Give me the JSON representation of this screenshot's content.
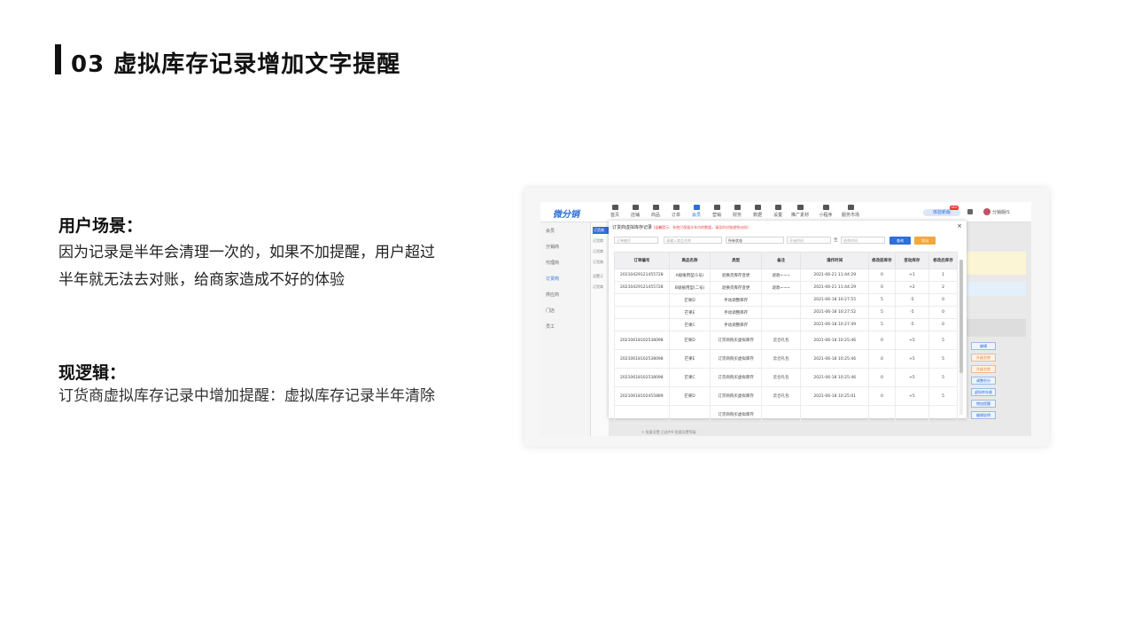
{
  "slide": {
    "title": "03 虚拟库存记录增加文字提醒",
    "scene_heading": "用户场景：",
    "scene_text": "因为记录是半年会清理一次的，如果不加提醒，用户超过半年就无法去对账，给商家造成不好的体验",
    "logic_heading": "现逻辑：",
    "logic_text": "订货商虚拟库存记录中增加提醒：虚拟库存记录半年清除"
  },
  "app": {
    "logo": "微分销",
    "nav": [
      {
        "label": "首页",
        "icon": "home-icon"
      },
      {
        "label": "店铺",
        "icon": "store-icon"
      },
      {
        "label": "商品",
        "icon": "goods-icon"
      },
      {
        "label": "订单",
        "icon": "order-icon"
      },
      {
        "label": "会员",
        "icon": "member-icon"
      },
      {
        "label": "营销",
        "icon": "marketing-icon"
      },
      {
        "label": "财务",
        "icon": "finance-icon"
      },
      {
        "label": "数据",
        "icon": "chart-icon"
      },
      {
        "label": "设置",
        "icon": "gear-icon"
      },
      {
        "label": "推广素材",
        "icon": "share-icon"
      },
      {
        "label": "小程序",
        "icon": "miniprogram-icon"
      },
      {
        "label": "服务市场",
        "icon": "market-icon"
      }
    ],
    "header_pill": "体验新版",
    "header_badge": "NEW",
    "user": "分销版IS",
    "sidebar": [
      "会员",
      "分销商",
      "代理商",
      "订货商",
      "供应商",
      "门店",
      "员工"
    ],
    "subnav": [
      "订货商",
      "订货商",
      "订货商",
      "订货商",
      "设置订",
      "订货商"
    ],
    "right_buttons": [
      "编辑",
      "升级名称",
      "升级名称",
      "调整积分",
      "虚拟库存维",
      "增加提醒",
      "编辑说明"
    ],
    "bottom_text": "+ 批量设置   已选中0   批量设置等级"
  },
  "modal": {
    "title": "订货商虚拟库存记录",
    "warning": "(温馨提示：系统只保留半年内的数据，请及时对账避免纠纷)",
    "close": "×",
    "filters": {
      "order_no_placeholder": "订单编号",
      "goods_placeholder": "请输入商品名称",
      "status_value": "所有状态",
      "start_placeholder": "开始时间",
      "to": "至",
      "end_placeholder": "结束时间",
      "search_label": "查询",
      "export_label": "导出"
    },
    "columns": [
      "订单编号",
      "商品名称",
      "类型",
      "备注",
      "操作时间",
      "修改前库存",
      "变动库存",
      "修改后库存"
    ],
    "rows": [
      [
        "20210429121455728",
        "A级植用型(1号)",
        "退换货库存变更",
        "退款~~~",
        "2021-06-21 11:44:29",
        "0",
        "+1",
        "1"
      ],
      [
        "20210429121455728",
        "B级植用型(二号)",
        "退换货库存变更",
        "退款~~~",
        "2021-06-21 11:44:29",
        "0",
        "+2",
        "2"
      ],
      [
        "",
        "芒果D",
        "手动调整库存",
        "",
        "2021-06-18 10:27:55",
        "5",
        "-5",
        "0"
      ],
      [
        "",
        "芒果E",
        "手动调整库存",
        "",
        "2021-06-18 10:27:52",
        "5",
        "-5",
        "0"
      ],
      [
        "",
        "芒果C",
        "手动调整库存",
        "",
        "2021-06-18 10:27:49",
        "5",
        "-5",
        "0"
      ],
      [
        "20210618102538098",
        "芒果D",
        "订货商购买虚拟库存",
        "云仓礼包",
        "2021-06-18 10:25:46",
        "0",
        "+5",
        "5"
      ],
      [
        "20210618102538098",
        "芒果E",
        "订货商购买虚拟库存",
        "云仓礼包",
        "2021-06-18 10:25:46",
        "0",
        "+5",
        "5"
      ],
      [
        "20210618102538098",
        "芒果C",
        "订货商购买虚拟库存",
        "云仓礼包",
        "2021-06-18 10:25:46",
        "0",
        "+5",
        "5"
      ],
      [
        "20210618102455889",
        "芒果D",
        "订货商购买虚拟库存",
        "云仓礼包",
        "2021-06-18 10:25:01",
        "0",
        "+5",
        "5"
      ],
      [
        "",
        "",
        "订货商购买虚拟库存",
        "",
        "",
        "",
        "",
        ""
      ]
    ]
  },
  "colors": {
    "accent": "#2e6fd8",
    "warning": "#e44444",
    "export": "#f0a93b"
  }
}
